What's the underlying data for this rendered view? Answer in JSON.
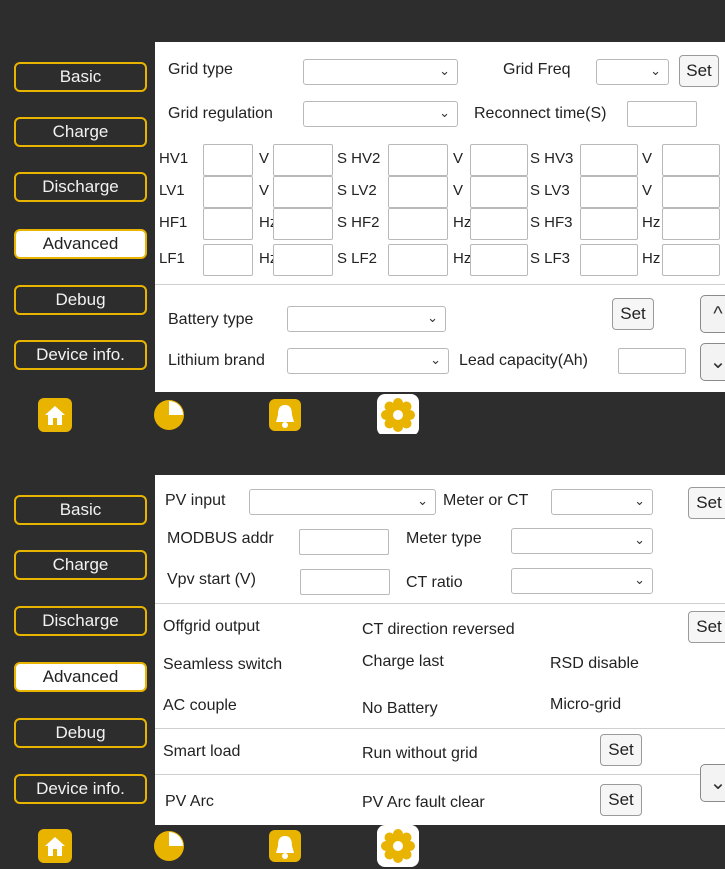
{
  "sidebar": {
    "items": [
      {
        "label": "Basic"
      },
      {
        "label": "Charge"
      },
      {
        "label": "Discharge"
      },
      {
        "label": "Advanced"
      },
      {
        "label": "Debug"
      },
      {
        "label": "Device info."
      }
    ],
    "active": "Advanced"
  },
  "screen1": {
    "grid_type_label": "Grid type",
    "grid_type_value": "",
    "grid_freq_label": "Grid Freq",
    "grid_freq_value": "",
    "set_label": "Set",
    "grid_regulation_label": "Grid regulation",
    "grid_regulation_value": "",
    "reconnect_label": "Reconnect time(S)",
    "reconnect_value": "",
    "rows": [
      {
        "c1": "HV1",
        "u1": "V",
        "c2": "S HV2",
        "u2": "V",
        "c3": "S HV3",
        "u3": "V"
      },
      {
        "c1": "LV1",
        "u1": "V",
        "c2": "S LV2",
        "u2": "V",
        "c3": "S LV3",
        "u3": "V"
      },
      {
        "c1": "HF1",
        "u1": "Hz",
        "c2": "S HF2",
        "u2": "Hz",
        "c3": "S HF3",
        "u3": "Hz"
      },
      {
        "c1": "LF1",
        "u1": "Hz",
        "c2": "S LF2",
        "u2": "Hz",
        "c3": "S LF3",
        "u3": "Hz"
      }
    ],
    "battery_type_label": "Battery type",
    "battery_type_value": "",
    "battery_set_label": "Set",
    "lithium_brand_label": "Lithium brand",
    "lithium_brand_value": "",
    "lead_capacity_label": "Lead capacity(Ah)",
    "lead_capacity_value": ""
  },
  "screen2": {
    "pv_input_label": "PV input",
    "pv_input_value": "",
    "meter_or_ct_label": "Meter or CT",
    "meter_or_ct_value": "",
    "set_label": "Set",
    "modbus_label": "MODBUS addr",
    "modbus_value": "",
    "meter_type_label": "Meter type",
    "meter_type_value": "",
    "vpv_start_label": "Vpv start (V)",
    "vpv_start_value": "",
    "ct_ratio_label": "CT ratio",
    "ct_ratio_value": "",
    "offgrid_output": "Offgrid output",
    "ct_direction": "CT direction reversed",
    "flags_set_label": "Set",
    "seamless_switch": "Seamless switch",
    "charge_last": "Charge last",
    "rsd_disable": "RSD disable",
    "ac_couple": "AC couple",
    "no_battery": "No Battery",
    "micro_grid": "Micro-grid",
    "smart_load": "Smart load",
    "run_without_grid": "Run without grid",
    "run_set_label": "Set",
    "pv_arc": "PV Arc",
    "pv_arc_fault_clear": "PV Arc fault clear",
    "pv_arc_set_label": "Set"
  },
  "icons": {
    "chevron": "⌄",
    "scroll_up": "^",
    "scroll_down": "⌄"
  },
  "colors": {
    "accent": "#e8b400",
    "background": "#2d2d2d",
    "panel": "#ffffff"
  }
}
